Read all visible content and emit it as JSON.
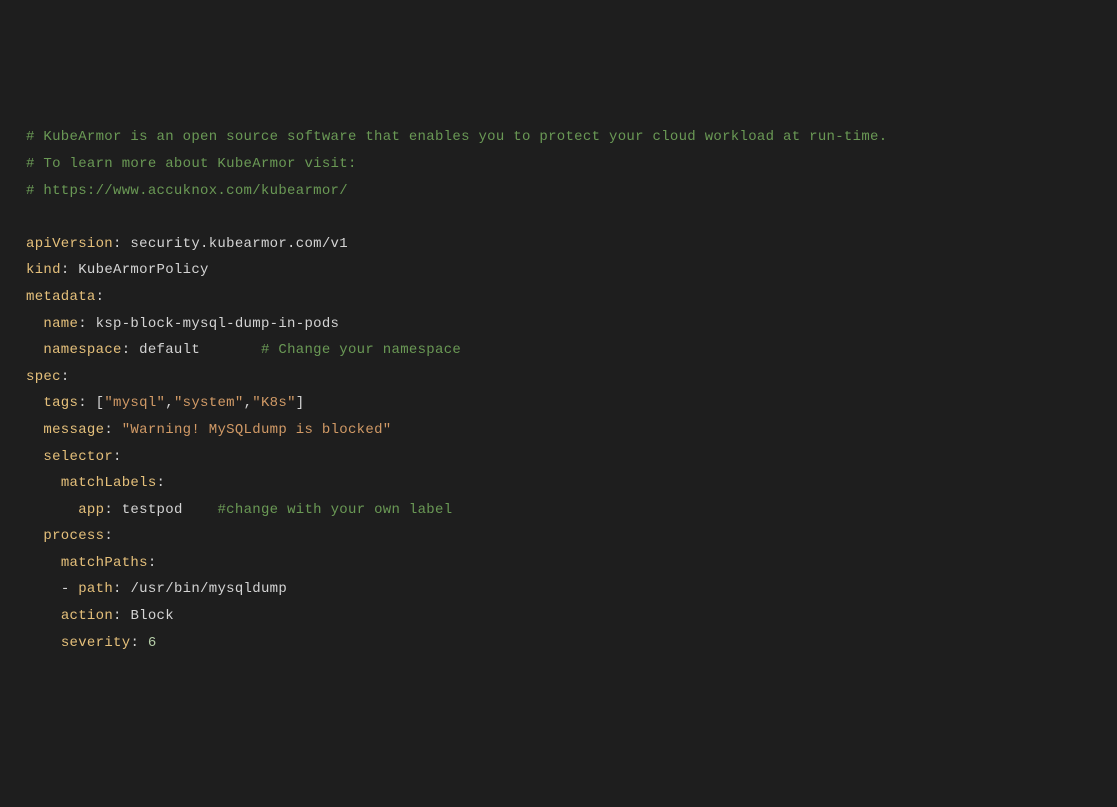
{
  "comments": {
    "line1": "# KubeArmor is an open source software that enables you to protect your cloud workload at run-time.",
    "line2": "# To learn more about KubeArmor visit:",
    "line3": "# https://www.accuknox.com/kubearmor/",
    "namespace_comment": "# Change your namespace",
    "label_comment": "#change with your own label"
  },
  "yaml": {
    "apiVersion_key": "apiVersion",
    "apiVersion_val": "security.kubearmor.com/v1",
    "kind_key": "kind",
    "kind_val": "KubeArmorPolicy",
    "metadata_key": "metadata",
    "name_key": "name",
    "name_val": "ksp-block-mysql-dump-in-pods",
    "namespace_key": "namespace",
    "namespace_val": "default",
    "spec_key": "spec",
    "tags_key": "tags",
    "tags_open": "[",
    "tag1": "\"mysql\"",
    "tag2": "\"system\"",
    "tag3": "\"K8s\"",
    "tags_close": "]",
    "message_key": "message",
    "message_val": "\"Warning! MySQLdump is blocked\"",
    "selector_key": "selector",
    "matchLabels_key": "matchLabels",
    "app_key": "app",
    "app_val": "testpod",
    "process_key": "process",
    "matchPaths_key": "matchPaths",
    "path_key": "path",
    "path_val": "/usr/bin/mysqldump",
    "action_key": "action",
    "action_val": "Block",
    "severity_key": "severity",
    "severity_val": "6"
  },
  "p": {
    "colon": ":",
    "colon_sp": ": ",
    "comma": ",",
    "dash": "- "
  }
}
